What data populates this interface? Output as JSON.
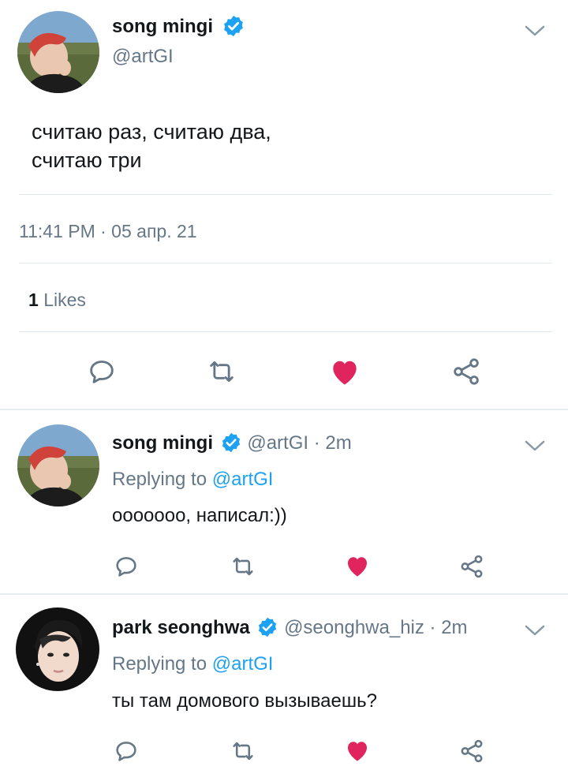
{
  "main_tweet": {
    "author_name": "song mingi",
    "author_handle": "@artGI",
    "text_line1": "считаю раз, считаю два,",
    "text_line2": "считаю три",
    "timestamp": "11:41 PM · 05 апр. 21",
    "likes_count": "1",
    "likes_label": "Likes"
  },
  "replies": [
    {
      "author_name": "song mingi",
      "author_handle": "@artGI",
      "time": "· 2m",
      "replying_prefix": "Replying to",
      "replying_to": "@artGI",
      "text": "ооооооо, написал:))"
    },
    {
      "author_name": "park seonghwa",
      "author_handle": "@seonghwa_hiz",
      "time": "· 2m",
      "replying_prefix": "Replying to",
      "replying_to": "@artGI",
      "text": "ты там домового вызываешь?"
    }
  ],
  "colors": {
    "like": "#e0245e",
    "link": "#1da1f2",
    "muted": "#657786",
    "verified": "#1da1f2"
  }
}
